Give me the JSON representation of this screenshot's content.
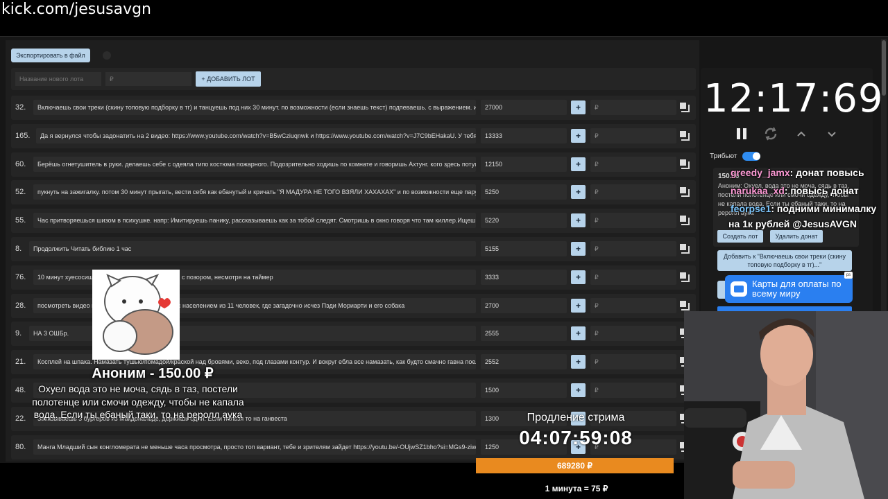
{
  "url": "kick.com/jesusavgn",
  "toolbar": {
    "export_label": "Экспортировать в файл"
  },
  "new_lot": {
    "name_placeholder": "Название нового лота",
    "price_placeholder": "₽",
    "add_label": "+ ДОБАВИТЬ ЛОТ"
  },
  "lots": [
    {
      "num": "32.",
      "text": "Включаешь свои треки (скину топовую подборку в тг) и танцуешь под них 30 минут. по возможности (если знаешь текст) подпеваешь. с выражением. и и",
      "amount": "27000"
    },
    {
      "num": "165.",
      "text": "Да я вернулся чтобы задонатить на 2 видео: https://www.youtube.com/watch?v=B5wCziuqnwk и https://www.youtube.com/watch?v=J7C9bEHakaU. У тебя к",
      "amount": "13333"
    },
    {
      "num": "60.",
      "text": "Берёшь огнетушитель в руки. делаешь себе с одеяла типо костюма пожарного. Подозрительно ходишь по комнате и говоришь Ахтунг. кого здесь потуш",
      "amount": "12150"
    },
    {
      "num": "52.",
      "text": "пукнуть на зажигалку. потом 30 минут прыгать, вести себя как ебанутый и кричать \"Я МАДУРА НЕ ТОГО ВЗЯЛИ ХАХАХАХ\" и по возможности еще пару р",
      "amount": "5250"
    },
    {
      "num": "55.",
      "text": "Час притворяешься шизом в психушке. напр: Имитируешь панику, рассказываешь как за тобой следят. Смотришь в окно говоря что там киллер.Ищешь с",
      "amount": "5220"
    },
    {
      "num": "8.",
      "text": "Продолжить Читать библию 1 час",
      "amount": "5155"
    },
    {
      "num": "76.",
      "text": "10 минут хуесосишь",
      "text2": "с позором, несмотря на таймер",
      "amount": "3333"
    },
    {
      "num": "28.",
      "text": "посмотреть видео на",
      "text2": "с населением из 11 человек, где загадочно исчез Пэди Мориарти и его собака",
      "amount": "2700"
    },
    {
      "num": "9.",
      "text": "НА 3 ОШБр.",
      "amount": "2555"
    },
    {
      "num": "21.",
      "text": "Косплей на шпака. Намазать тушью/помадой/краской над бровями, веко, под глазами контур. И вокруг ебла все намазать, как будто смачно гавна поел.",
      "amount": "2552"
    },
    {
      "num": "48.",
      "text": "",
      "amount": "1500"
    },
    {
      "num": "22.",
      "text": "Заказываешь 3 бургеров из Макдональдс, держишь один. Если нельзя то на ганвеста",
      "amount": "1300"
    },
    {
      "num": "80.",
      "text": "Манга Младший сын конгломерата не меньше часа просмотра, просто топ вариант, тебе и зрителям зайдет https://youtu.be/-OUjwSZ1bho?si=MGs9-ziwl",
      "amount": "1250"
    }
  ],
  "add_placeholder": "₽",
  "timer": {
    "value": "12:17:69"
  },
  "tribute": {
    "label": "Трибьют"
  },
  "donation": {
    "amount": "150.00",
    "text": "Аноним: Охуел, вода это не моча, сядь в таз, постели полотенце или смочи одежду, чтобы не капала вода. Если ты ебаный таки, то на реролл аука",
    "create_lot": "Создать лот",
    "delete_donation": "Удалить донат",
    "add_to": "Добавить к \"Включаешь свои треки (скину топовую подборку в тг)...\""
  },
  "ad": {
    "text": "Карты для оплаты по всему миру",
    "badge": "ps"
  },
  "chat": [
    {
      "user": "greedy_jamx",
      "msg": ": донат повысь"
    },
    {
      "user": "narukaa_xd",
      "msg": ": повысь донат"
    },
    {
      "user": "feorpse1",
      "msg": ": подними минималку"
    },
    {
      "user": "",
      "msg": "на 1к рублей @JesusAVGN"
    }
  ],
  "alert": {
    "title": "Аноним - 150.00 ₽",
    "message": "Охуел вода это не моча, сядь в таз, постели полотенце или смочи одежду, чтобы не капала вода. Если ты ебаный таки, то на реролл аука"
  },
  "extension": {
    "label": "Продление стрима",
    "time": "04:07:59:08",
    "total": "689280 ₽",
    "rate": "1 минута = 75 ₽"
  },
  "colors": {
    "accent": "#b7d3ea",
    "toggle": "#2f8cf0",
    "progress": "#e98a1f"
  }
}
